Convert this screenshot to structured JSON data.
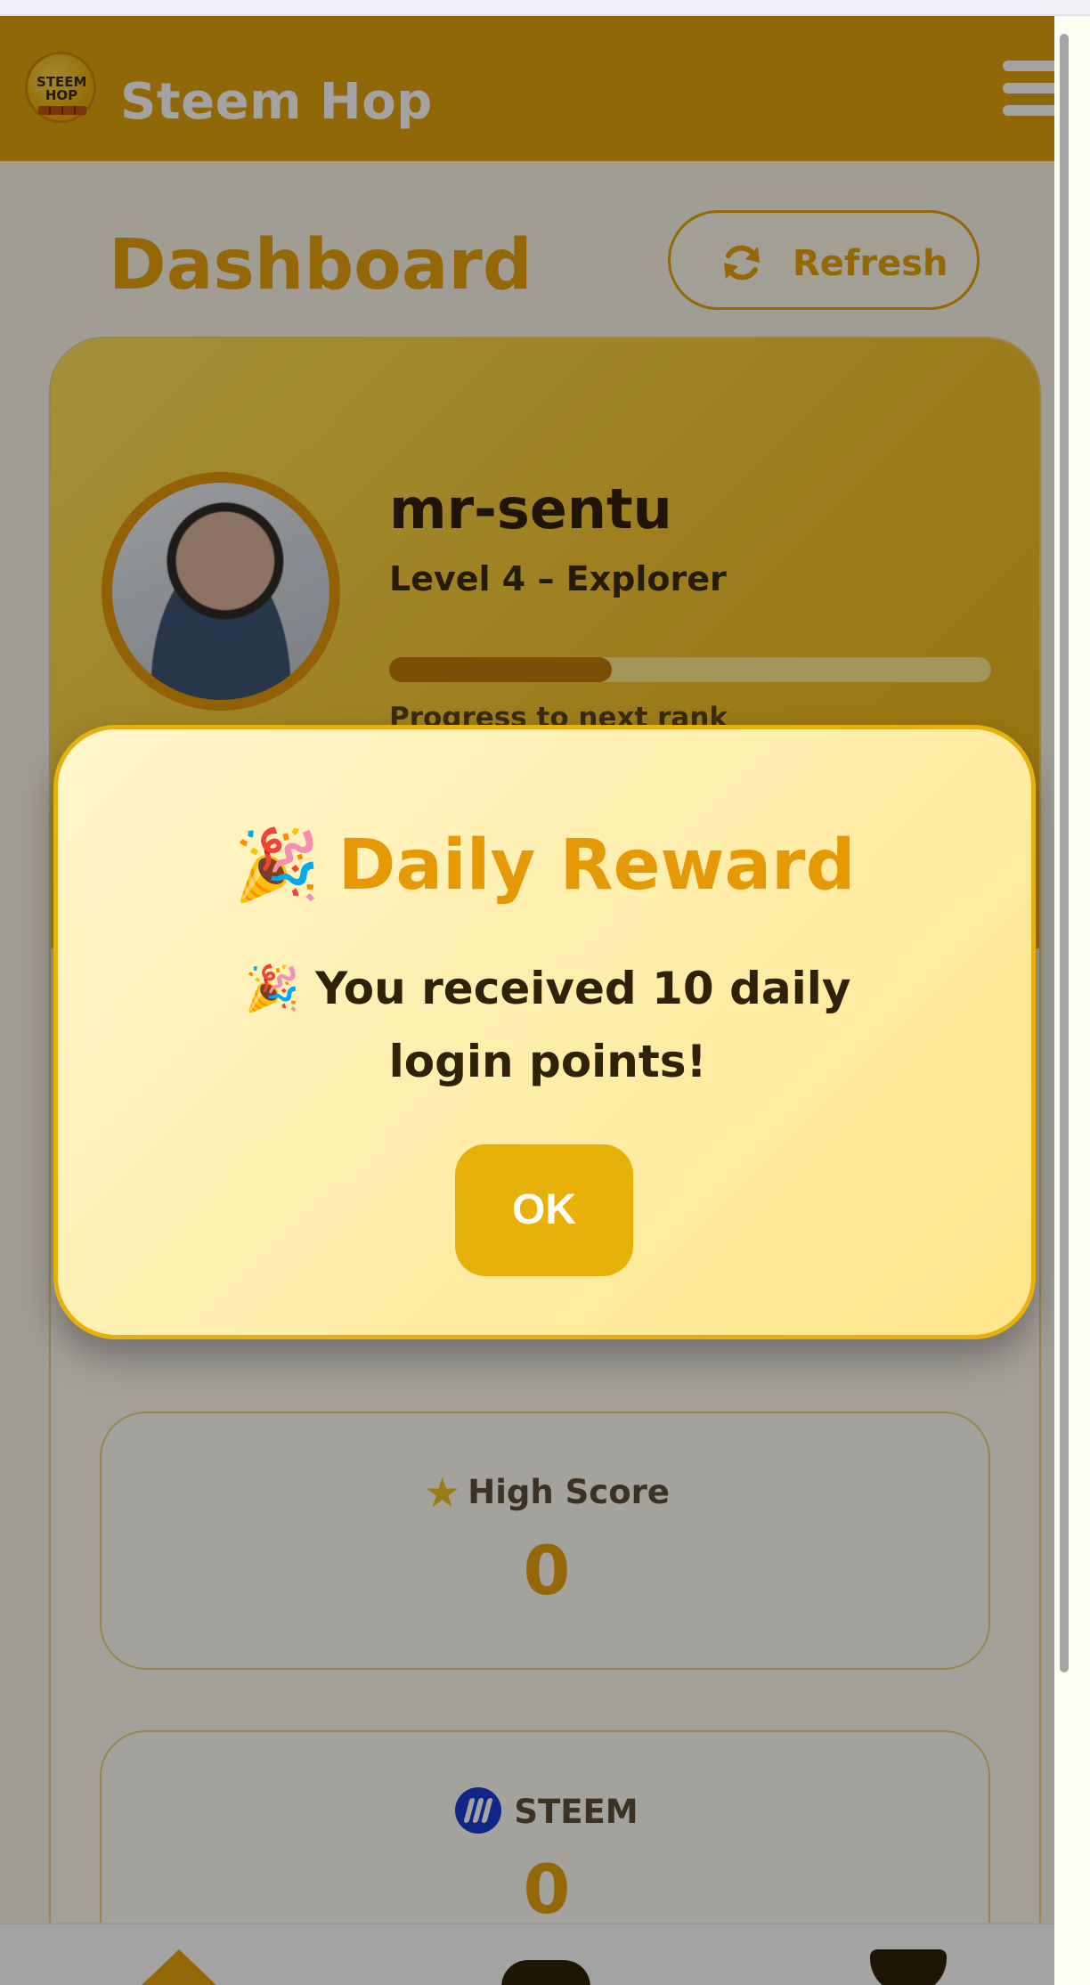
{
  "header": {
    "app_title": "Steem Hop",
    "logo_text": "STEEM HOP"
  },
  "dashboard": {
    "title": "Dashboard",
    "refresh_label": "Refresh"
  },
  "profile": {
    "username": "mr-sentu",
    "level": "Level 4 – Explorer",
    "progress_fraction": 0.37,
    "progress_label": "Progress to next rank"
  },
  "stats": {
    "high_score_label": "High Score",
    "high_score_value": "0",
    "steem_label": "STEEM",
    "steem_value": "0"
  },
  "modal": {
    "title_emoji": "🎉",
    "title": "Daily Reward",
    "message": "🎉 You received 10 daily login points!",
    "ok_label": "OK"
  },
  "colors": {
    "brand": "#e3a30b",
    "accent": "#e8a10c",
    "text_dark": "#2f2208",
    "steem_blue": "#1a3cd4"
  },
  "icons": {
    "menu": "hamburger-icon",
    "refresh": "refresh-icon",
    "star": "star-icon",
    "steem": "steem-icon",
    "home": "home-icon",
    "game": "gamepad-icon",
    "trophy": "trophy-icon"
  }
}
